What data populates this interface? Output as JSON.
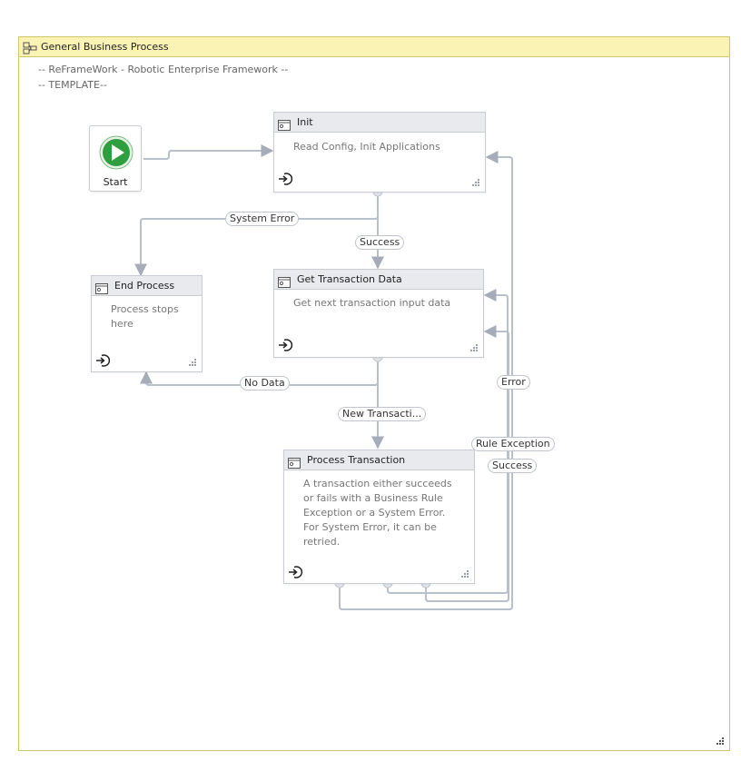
{
  "container": {
    "title": "General Business Process",
    "icon": "flowchart-icon"
  },
  "annotation": {
    "line1": "-- ReFrameWork - Robotic Enterprise Framework --",
    "line2": "-- TEMPLATE--"
  },
  "start": {
    "label": "Start",
    "icon": "play-icon"
  },
  "states": {
    "init": {
      "title": "Init",
      "description": "Read Config, Init Applications"
    },
    "end_process": {
      "title": "End Process",
      "description": "Process stops here"
    },
    "get_transaction": {
      "title": "Get Transaction Data",
      "description": "Get next transaction input data"
    },
    "process_transaction": {
      "title": "Process Transaction",
      "description": "A transaction either succeeds or fails with a Business Rule Exception or a System Error. For System Error, it can be retried."
    }
  },
  "transitions": {
    "system_error": "System Error",
    "success_init": "Success",
    "no_data": "No Data",
    "new_transaction": "New Transacti...",
    "error": "Error",
    "rule_exception": "Rule Exception",
    "success_process": "Success"
  },
  "colors": {
    "container_border": "#cfc66a",
    "container_header": "#fbf3b3",
    "connector": "#b8c0cc",
    "start_green": "#2e9e3e",
    "state_header": "#e8eaed"
  }
}
